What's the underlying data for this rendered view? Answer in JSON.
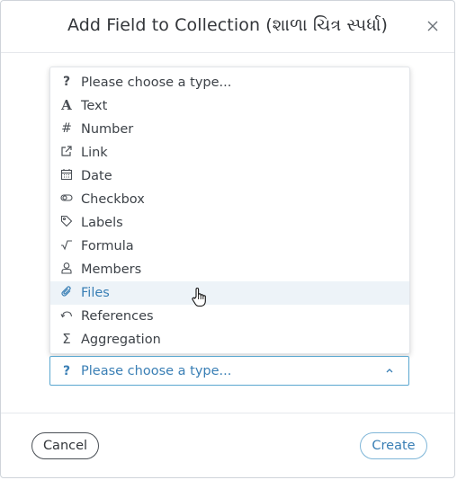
{
  "dialog": {
    "title": "Add Field to Collection (શાળા ચિત્ર સ્પર્ધા)",
    "close_icon": "close-icon"
  },
  "type_menu": {
    "highlighted_index": 9,
    "items": [
      {
        "label": "Please choose a type...",
        "icon": "question-icon"
      },
      {
        "label": "Text",
        "icon": "text-icon"
      },
      {
        "label": "Number",
        "icon": "hash-icon"
      },
      {
        "label": "Link",
        "icon": "external-link-icon"
      },
      {
        "label": "Date",
        "icon": "calendar-icon"
      },
      {
        "label": "Checkbox",
        "icon": "toggle-icon"
      },
      {
        "label": "Labels",
        "icon": "tag-icon"
      },
      {
        "label": "Formula",
        "icon": "square-root-icon"
      },
      {
        "label": "Members",
        "icon": "person-icon"
      },
      {
        "label": "Files",
        "icon": "paperclip-icon"
      },
      {
        "label": "References",
        "icon": "undo-arrow-icon"
      },
      {
        "label": "Aggregation",
        "icon": "sigma-icon"
      }
    ]
  },
  "type_select": {
    "value": "Please choose a type...",
    "icon": "question-icon",
    "chevron": "chevron-up-icon"
  },
  "footer": {
    "cancel_label": "Cancel",
    "create_label": "Create"
  },
  "colors": {
    "accent": "#3a7fb5",
    "highlight_bg": "#edf3f8",
    "select_border": "#5aa7d0"
  }
}
